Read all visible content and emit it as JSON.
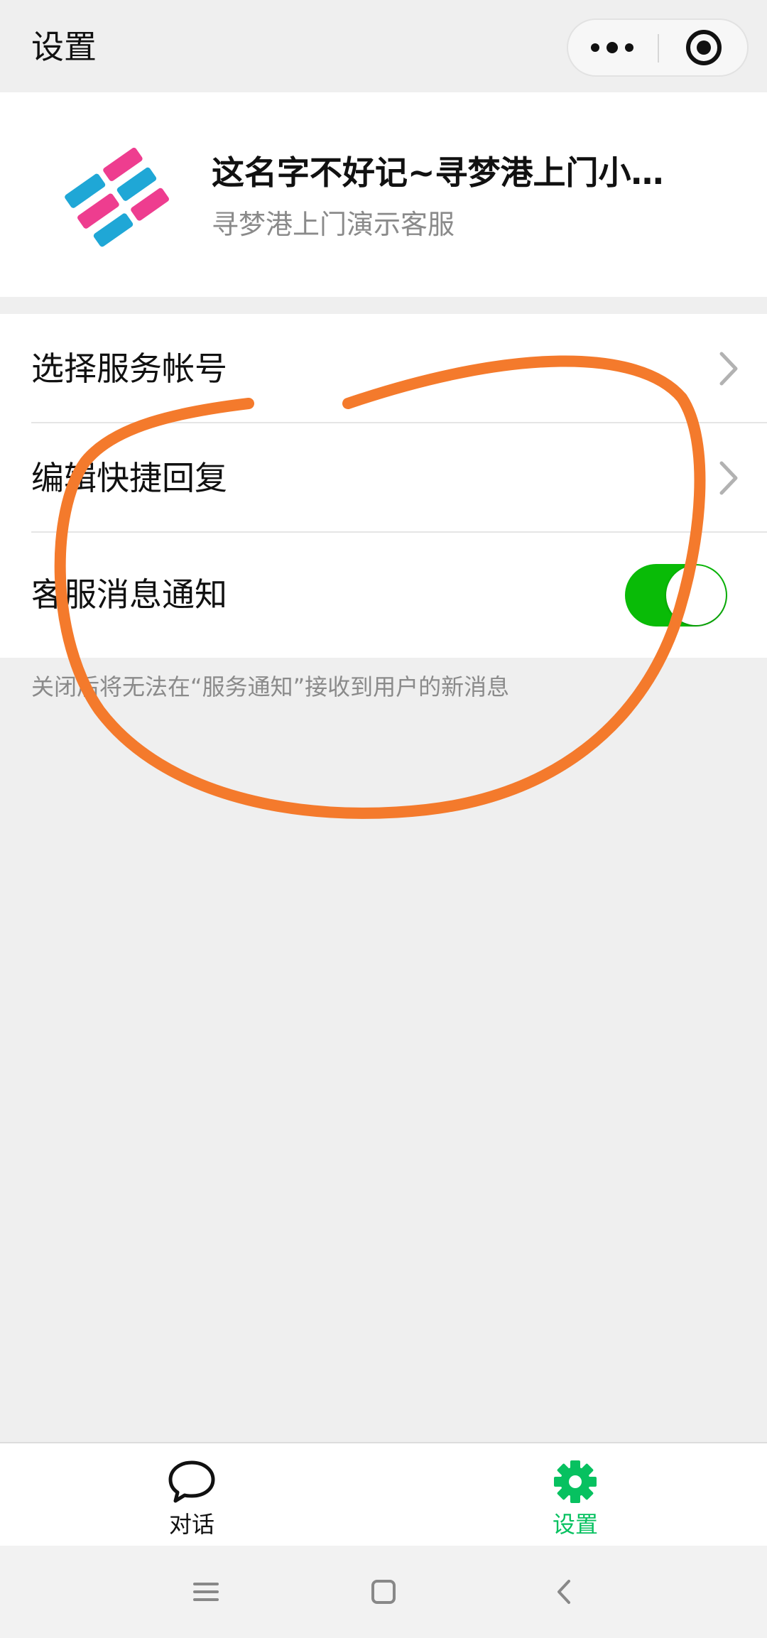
{
  "header": {
    "title": "设置"
  },
  "capsule": {
    "more_icon": "more-dots-icon",
    "target_icon": "target-circle-icon"
  },
  "profile": {
    "logo_icon": "brand-logo-icon",
    "name": "这名字不好记~寻梦港上门小…",
    "subtitle": "寻梦港上门演示客服"
  },
  "settings": {
    "items": [
      {
        "label": "选择服务帐号",
        "type": "link"
      },
      {
        "label": "编辑快捷回复",
        "type": "link"
      },
      {
        "label": "客服消息通知",
        "type": "toggle",
        "on": true
      }
    ],
    "hint": "关闭后将无法在“服务通知”接收到用户的新消息"
  },
  "tabbar": {
    "tabs": [
      {
        "label": "对话",
        "icon": "chat-bubble-icon",
        "active": false
      },
      {
        "label": "设置",
        "icon": "gear-icon",
        "active": true
      }
    ]
  },
  "navbar": {
    "icons": [
      "menu-lines-icon",
      "home-square-icon",
      "back-chevron-icon"
    ]
  },
  "colors": {
    "accent": "#07c160",
    "toggle_on": "#09bb07",
    "annotation": "#f47a2c",
    "logo_blue": "#1fa7d6",
    "logo_pink": "#ee3d8f",
    "background": "#efefef"
  }
}
